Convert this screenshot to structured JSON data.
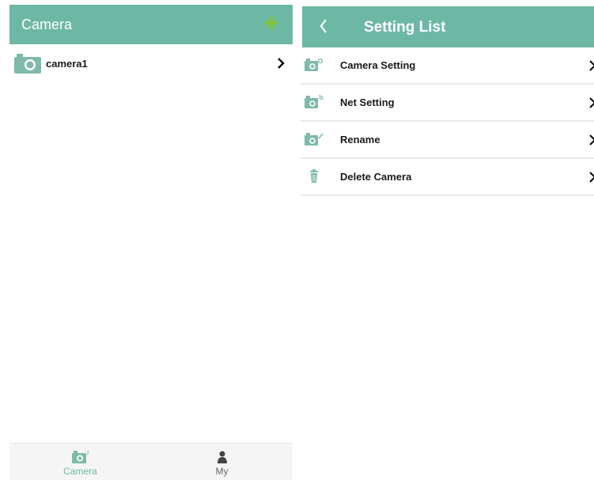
{
  "left": {
    "title": "Camera",
    "camera_list": [
      {
        "name": "camera1"
      }
    ],
    "tabs": [
      {
        "label": "Camera",
        "icon": "camera-icon",
        "active": true
      },
      {
        "label": "My",
        "icon": "person-icon",
        "active": false
      }
    ]
  },
  "right": {
    "title": "Setting List",
    "items": [
      {
        "label": "Camera Setting",
        "icon": "camera-settings-icon"
      },
      {
        "label": "Net Setting",
        "icon": "camera-network-icon"
      },
      {
        "label": "Rename",
        "icon": "camera-edit-icon"
      },
      {
        "label": "Delete Camera",
        "icon": "trash-icon"
      }
    ]
  },
  "colors": {
    "header": "#6db8a4",
    "add": "#7dc242",
    "tab_active": "#6db8a4",
    "icon": "#7fb9a9"
  }
}
